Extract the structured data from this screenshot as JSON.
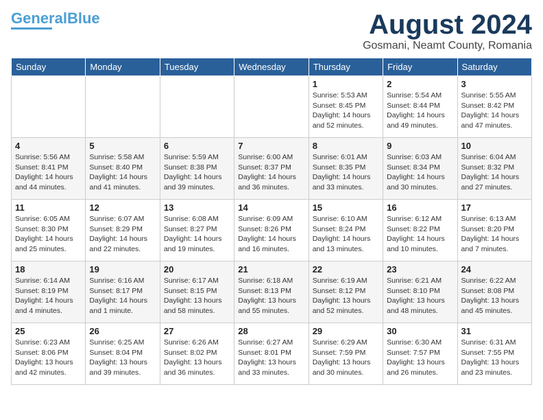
{
  "header": {
    "logo_line1": "General",
    "logo_line2": "Blue",
    "month_year": "August 2024",
    "location": "Gosmani, Neamt County, Romania"
  },
  "weekdays": [
    "Sunday",
    "Monday",
    "Tuesday",
    "Wednesday",
    "Thursday",
    "Friday",
    "Saturday"
  ],
  "weeks": [
    [
      {
        "day": "",
        "content": ""
      },
      {
        "day": "",
        "content": ""
      },
      {
        "day": "",
        "content": ""
      },
      {
        "day": "",
        "content": ""
      },
      {
        "day": "1",
        "content": "Sunrise: 5:53 AM\nSunset: 8:45 PM\nDaylight: 14 hours\nand 52 minutes."
      },
      {
        "day": "2",
        "content": "Sunrise: 5:54 AM\nSunset: 8:44 PM\nDaylight: 14 hours\nand 49 minutes."
      },
      {
        "day": "3",
        "content": "Sunrise: 5:55 AM\nSunset: 8:42 PM\nDaylight: 14 hours\nand 47 minutes."
      }
    ],
    [
      {
        "day": "4",
        "content": "Sunrise: 5:56 AM\nSunset: 8:41 PM\nDaylight: 14 hours\nand 44 minutes."
      },
      {
        "day": "5",
        "content": "Sunrise: 5:58 AM\nSunset: 8:40 PM\nDaylight: 14 hours\nand 41 minutes."
      },
      {
        "day": "6",
        "content": "Sunrise: 5:59 AM\nSunset: 8:38 PM\nDaylight: 14 hours\nand 39 minutes."
      },
      {
        "day": "7",
        "content": "Sunrise: 6:00 AM\nSunset: 8:37 PM\nDaylight: 14 hours\nand 36 minutes."
      },
      {
        "day": "8",
        "content": "Sunrise: 6:01 AM\nSunset: 8:35 PM\nDaylight: 14 hours\nand 33 minutes."
      },
      {
        "day": "9",
        "content": "Sunrise: 6:03 AM\nSunset: 8:34 PM\nDaylight: 14 hours\nand 30 minutes."
      },
      {
        "day": "10",
        "content": "Sunrise: 6:04 AM\nSunset: 8:32 PM\nDaylight: 14 hours\nand 27 minutes."
      }
    ],
    [
      {
        "day": "11",
        "content": "Sunrise: 6:05 AM\nSunset: 8:30 PM\nDaylight: 14 hours\nand 25 minutes."
      },
      {
        "day": "12",
        "content": "Sunrise: 6:07 AM\nSunset: 8:29 PM\nDaylight: 14 hours\nand 22 minutes."
      },
      {
        "day": "13",
        "content": "Sunrise: 6:08 AM\nSunset: 8:27 PM\nDaylight: 14 hours\nand 19 minutes."
      },
      {
        "day": "14",
        "content": "Sunrise: 6:09 AM\nSunset: 8:26 PM\nDaylight: 14 hours\nand 16 minutes."
      },
      {
        "day": "15",
        "content": "Sunrise: 6:10 AM\nSunset: 8:24 PM\nDaylight: 14 hours\nand 13 minutes."
      },
      {
        "day": "16",
        "content": "Sunrise: 6:12 AM\nSunset: 8:22 PM\nDaylight: 14 hours\nand 10 minutes."
      },
      {
        "day": "17",
        "content": "Sunrise: 6:13 AM\nSunset: 8:20 PM\nDaylight: 14 hours\nand 7 minutes."
      }
    ],
    [
      {
        "day": "18",
        "content": "Sunrise: 6:14 AM\nSunset: 8:19 PM\nDaylight: 14 hours\nand 4 minutes."
      },
      {
        "day": "19",
        "content": "Sunrise: 6:16 AM\nSunset: 8:17 PM\nDaylight: 14 hours\nand 1 minute."
      },
      {
        "day": "20",
        "content": "Sunrise: 6:17 AM\nSunset: 8:15 PM\nDaylight: 13 hours\nand 58 minutes."
      },
      {
        "day": "21",
        "content": "Sunrise: 6:18 AM\nSunset: 8:13 PM\nDaylight: 13 hours\nand 55 minutes."
      },
      {
        "day": "22",
        "content": "Sunrise: 6:19 AM\nSunset: 8:12 PM\nDaylight: 13 hours\nand 52 minutes."
      },
      {
        "day": "23",
        "content": "Sunrise: 6:21 AM\nSunset: 8:10 PM\nDaylight: 13 hours\nand 48 minutes."
      },
      {
        "day": "24",
        "content": "Sunrise: 6:22 AM\nSunset: 8:08 PM\nDaylight: 13 hours\nand 45 minutes."
      }
    ],
    [
      {
        "day": "25",
        "content": "Sunrise: 6:23 AM\nSunset: 8:06 PM\nDaylight: 13 hours\nand 42 minutes."
      },
      {
        "day": "26",
        "content": "Sunrise: 6:25 AM\nSunset: 8:04 PM\nDaylight: 13 hours\nand 39 minutes."
      },
      {
        "day": "27",
        "content": "Sunrise: 6:26 AM\nSunset: 8:02 PM\nDaylight: 13 hours\nand 36 minutes."
      },
      {
        "day": "28",
        "content": "Sunrise: 6:27 AM\nSunset: 8:01 PM\nDaylight: 13 hours\nand 33 minutes."
      },
      {
        "day": "29",
        "content": "Sunrise: 6:29 AM\nSunset: 7:59 PM\nDaylight: 13 hours\nand 30 minutes."
      },
      {
        "day": "30",
        "content": "Sunrise: 6:30 AM\nSunset: 7:57 PM\nDaylight: 13 hours\nand 26 minutes."
      },
      {
        "day": "31",
        "content": "Sunrise: 6:31 AM\nSunset: 7:55 PM\nDaylight: 13 hours\nand 23 minutes."
      }
    ]
  ]
}
